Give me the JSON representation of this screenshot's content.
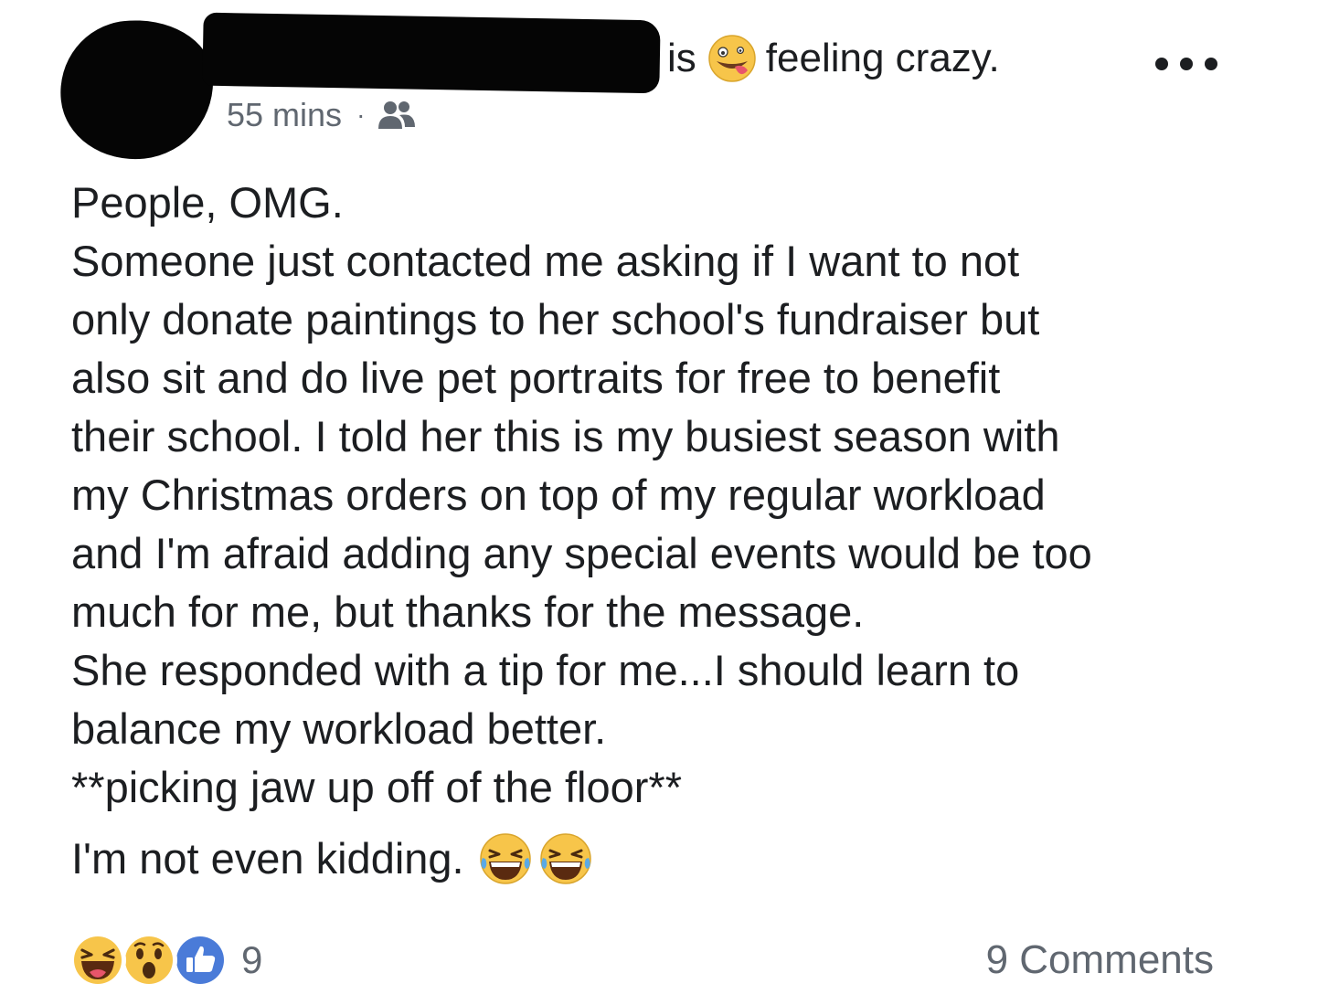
{
  "post": {
    "author_redacted": true,
    "status_is": "is",
    "status_feeling": "feeling crazy.",
    "feeling_icon": "crazy-face-emoji",
    "timestamp": "55 mins",
    "separator": "·",
    "audience_icon": "friends-icon",
    "body_lines": [
      "People, OMG.",
      "Someone just contacted me asking if I want to not",
      "only donate paintings to her school's fundraiser but",
      "also sit and do live pet portraits for free to benefit",
      "their school. I told her this is my busiest season with",
      "my Christmas orders on top of my regular workload",
      "and I'm afraid adding any special events would be too",
      "much for me, but thanks for the message.",
      "She responded with a tip for me...I should learn to",
      "balance my workload better.",
      "**picking jaw up off of the floor**"
    ],
    "last_line": "I'm not even kidding.",
    "last_line_emojis": [
      "laughing-tears-emoji",
      "laughing-tears-emoji"
    ]
  },
  "footer": {
    "reaction_icons": [
      "haha-reaction",
      "wow-reaction",
      "like-reaction"
    ],
    "reaction_count": "9",
    "comments_label": "9 Comments"
  },
  "colors": {
    "text": "#1c1e21",
    "secondary_text": "#606770",
    "like_blue": "#4a7bd8",
    "emoji_yellow": "#f7c54a"
  }
}
